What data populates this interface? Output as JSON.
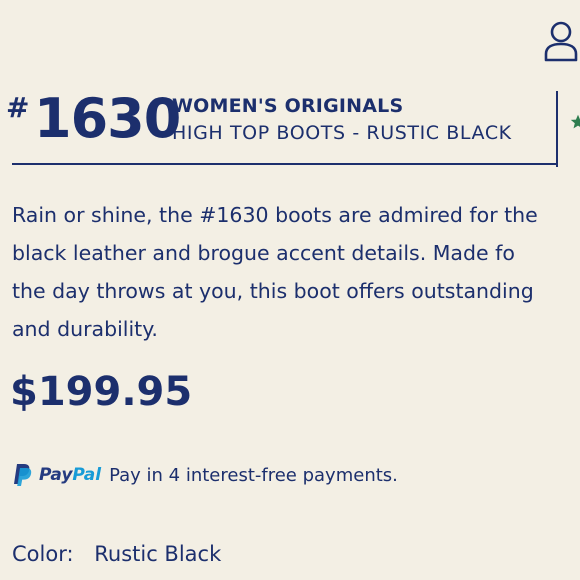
{
  "header": {
    "hash": "#",
    "model_number": "1630",
    "collection": "WOMEN'S ORIGINALS",
    "product_name": "HIGH TOP BOOTS - RUSTIC BLACK"
  },
  "description": {
    "lines": [
      "Rain or shine, the #1630 boots are admired for the",
      "black leather and brogue accent details. Made fo",
      "the day throws at you, this boot offers outstanding",
      "and durability."
    ]
  },
  "price": "$199.95",
  "paypal": {
    "brand_pay": "Pay",
    "brand_pal": "Pal",
    "message": "Pay in 4 interest-free payments."
  },
  "color": {
    "label": "Color:",
    "value": "Rustic Black"
  },
  "icons": {
    "account": "user-icon",
    "rating": "star-icon",
    "paypal": "paypal-icon"
  },
  "colors": {
    "text": "#1c2f6d",
    "background": "#f3efe4",
    "paypal_dark": "#253b80",
    "paypal_light": "#179bd7",
    "star": "#2e7d4f"
  }
}
